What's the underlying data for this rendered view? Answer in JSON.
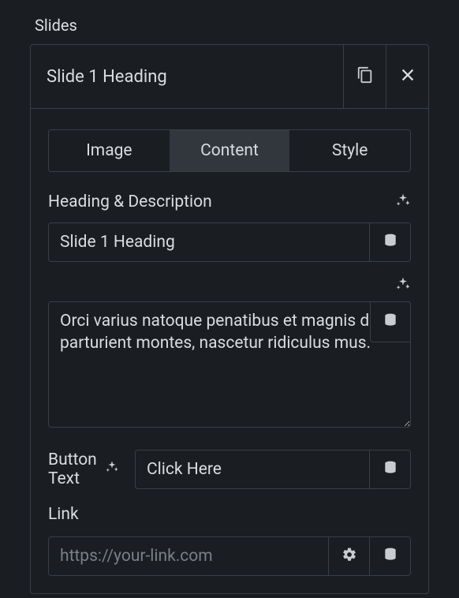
{
  "section_label": "Slides",
  "header": {
    "title": "Slide 1 Heading"
  },
  "tabs": [
    {
      "label": "Image",
      "active": false
    },
    {
      "label": "Content",
      "active": true
    },
    {
      "label": "Style",
      "active": false
    }
  ],
  "heading_desc_label": "Heading & Description",
  "heading_value": "Slide 1 Heading",
  "description_value": "Orci varius natoque penatibus et magnis dis parturient montes, nascetur ridiculus mus.",
  "button_text_label": "Button Text",
  "button_text_value": "Click Here",
  "link_label": "Link",
  "link_placeholder": "https://your-link.com"
}
